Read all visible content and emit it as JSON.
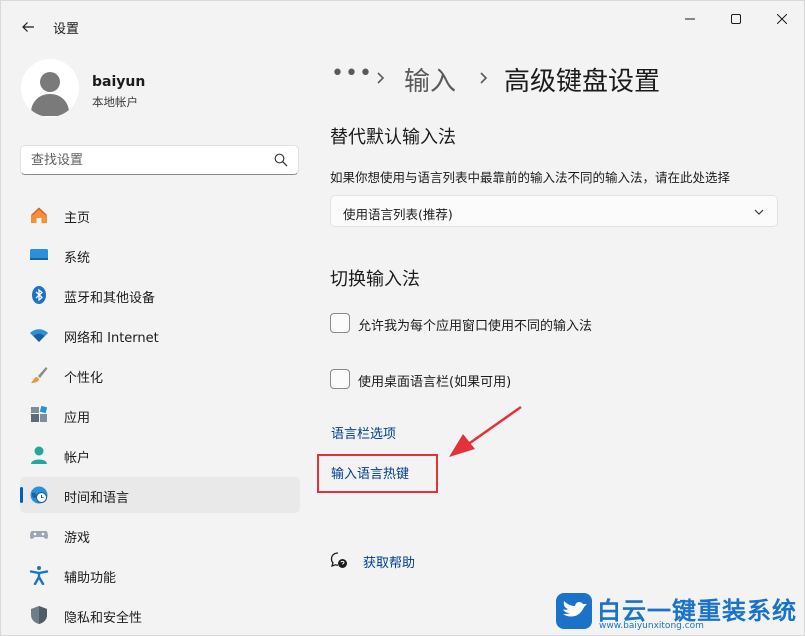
{
  "window": {
    "title": "设置"
  },
  "profile": {
    "name": "baiyun",
    "account_type": "本地帐户"
  },
  "search": {
    "placeholder": "查找设置"
  },
  "sidebar": {
    "items": [
      {
        "label": "主页",
        "icon": "home-icon"
      },
      {
        "label": "系统",
        "icon": "system-icon"
      },
      {
        "label": "蓝牙和其他设备",
        "icon": "bluetooth-icon"
      },
      {
        "label": "网络和 Internet",
        "icon": "wifi-icon"
      },
      {
        "label": "个性化",
        "icon": "brush-icon"
      },
      {
        "label": "应用",
        "icon": "apps-icon"
      },
      {
        "label": "帐户",
        "icon": "account-icon"
      },
      {
        "label": "时间和语言",
        "icon": "globe-clock-icon",
        "active": true
      },
      {
        "label": "游戏",
        "icon": "gamepad-icon"
      },
      {
        "label": "辅助功能",
        "icon": "accessibility-icon"
      },
      {
        "label": "隐私和安全性",
        "icon": "shield-icon"
      }
    ]
  },
  "breadcrumb": {
    "more": "•••",
    "parent": "输入",
    "current": "高级键盘设置"
  },
  "main": {
    "override_section": {
      "title": "替代默认输入法",
      "description": "如果你想使用与语言列表中最靠前的输入法不同的输入法，请在此处选择",
      "dropdown_value": "使用语言列表(推荐)"
    },
    "switch_section": {
      "title": "切换输入法",
      "checkbox1_label": "允许我为每个应用窗口使用不同的输入法",
      "checkbox2_label": "使用桌面语言栏(如果可用)"
    },
    "links": {
      "language_bar_options": "语言栏选项",
      "input_language_hotkeys": "输入语言热键"
    },
    "help": {
      "label": "获取帮助"
    }
  },
  "watermark": {
    "title": "白云一键重装系统",
    "url": "www.baiyunxitong.com"
  },
  "colors": {
    "accent": "#005fb8",
    "link": "#003e92",
    "annotation_red": "#e2323a",
    "watermark_blue": "#1a73c8"
  }
}
